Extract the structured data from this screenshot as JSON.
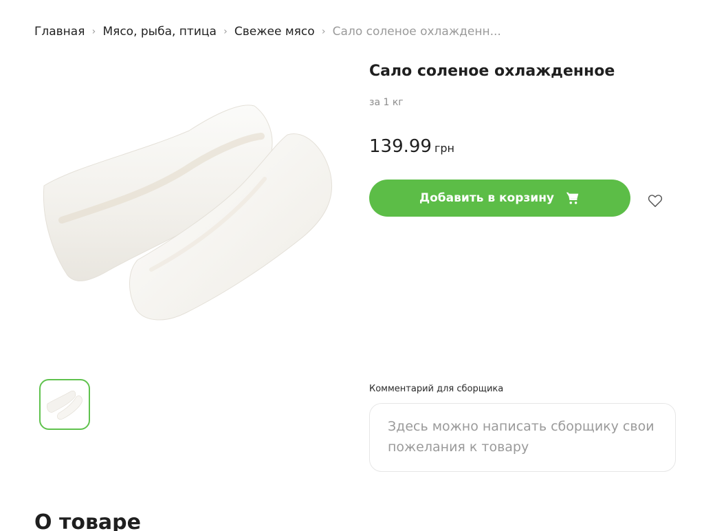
{
  "breadcrumb": {
    "items": [
      {
        "label": "Главная"
      },
      {
        "label": "Мясо, рыба, птица"
      },
      {
        "label": "Свежее мясо"
      }
    ],
    "current": "Сало соленое охлажденн..."
  },
  "product": {
    "title": "Сало соленое охлажденное",
    "unit": "за 1 кг",
    "price": "139.99",
    "currency": "грн",
    "add_to_cart_label": "Добавить в корзину",
    "image_icon": "salo-product-image",
    "favorite_icon": "heart-icon",
    "cart_icon": "cart-icon"
  },
  "comment": {
    "label": "Комментарий для сборщика",
    "placeholder": "Здесь можно написать сборщику свои пожелания к товару",
    "value": ""
  },
  "about": {
    "heading": "О товаре"
  },
  "colors": {
    "accent": "#5cbd47",
    "thumb_border": "#5fc24d",
    "muted_text": "#9a9a9a"
  }
}
